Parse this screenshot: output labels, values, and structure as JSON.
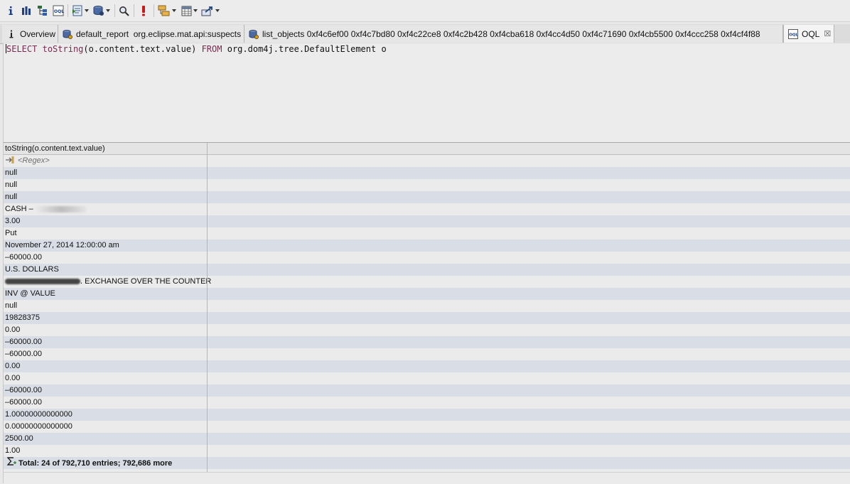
{
  "toolbar": {
    "icons": [
      "info-icon",
      "histogram-icon",
      "dominator-tree-icon",
      "oql-icon",
      "report-icon",
      "heap-dump-icon",
      "search-icon",
      "leak-icon",
      "grouping-icon",
      "calculator-icon",
      "export-icon"
    ]
  },
  "tabs": [
    {
      "label": "Overview",
      "icon": "info-icon"
    },
    {
      "label": "default_report  org.eclipse.mat.api:suspects",
      "icon": "report-icon"
    },
    {
      "label": "list_objects 0xf4c6ef00 0xf4c7bd80 0xf4c22ce8 0xf4c2b428 0xf4cba618 0xf4cc4d50 0xf4c71690 0xf4cb5500 0xf4ccc258 0xf4cf4f88",
      "icon": "report-icon"
    },
    {
      "label": "OQL",
      "icon": "oql-icon",
      "active": true,
      "close": "☒"
    }
  ],
  "editor": {
    "kw_select": "SELECT",
    "fn": "toString",
    "args": "(o.content.text.value)",
    "kw_from": "FROM",
    "class": "org.dom4j.tree.DefaultElement o"
  },
  "results": {
    "column_header": "toString(o.content.text.value)",
    "regex_placeholder": "<Regex>",
    "rows": [
      "null",
      "null",
      "null",
      "CASH –",
      "3.00",
      "Put",
      "November 27, 2014 12:00:00 am",
      "–60000.00",
      "U.S. DOLLARS",
      ". EXCHANGE OVER THE COUNTER",
      "INV @ VALUE",
      "null",
      "19828375",
      "0.00",
      "–60000.00",
      "–60000.00",
      "0.00",
      "0.00",
      "–60000.00",
      "–60000.00",
      "1.00000000000000",
      "0.00000000000000",
      "2500.00",
      "1.00"
    ],
    "total": "Total: 24 of 792,710 entries; 792,686 more"
  }
}
